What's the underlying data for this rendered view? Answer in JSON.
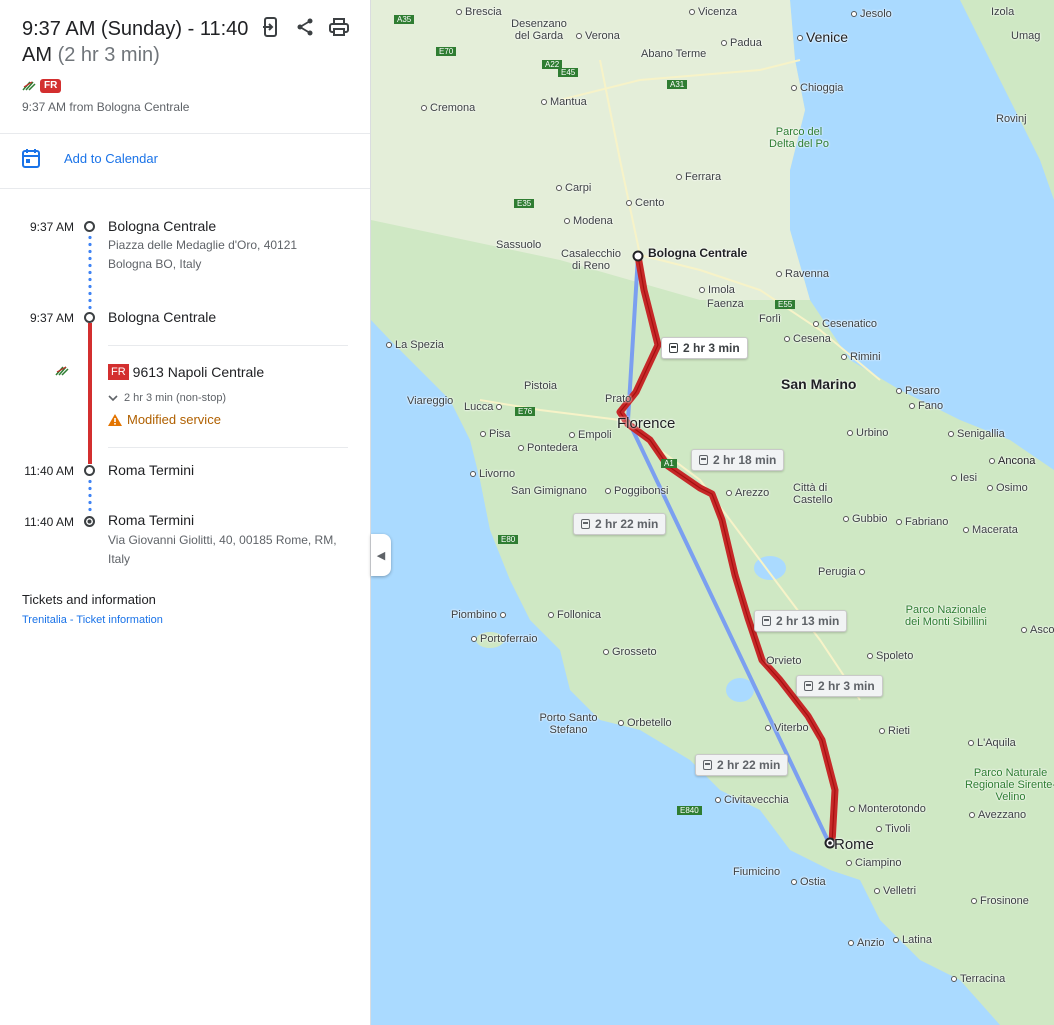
{
  "header": {
    "time_range": "9:37 AM (Sunday) - 11:40 AM",
    "duration": "(2 hr 3 min)",
    "badge": "FR",
    "from_text": "9:37 AM from Bologna Centrale",
    "icons": [
      "send-to-phone-icon",
      "share-icon",
      "print-icon"
    ]
  },
  "calendar": {
    "label": "Add to Calendar"
  },
  "itinerary": {
    "start": {
      "time": "9:37 AM",
      "name": "Bologna Centrale",
      "address_line1": "Piazza delle Medaglie d'Oro, 40121",
      "address_line2": "Bologna BO, Italy"
    },
    "board": {
      "time": "9:37 AM",
      "name": "Bologna Centrale"
    },
    "train": {
      "badge": "FR",
      "label": "9613 Napoli Centrale",
      "duration": "2 hr 3 min (non-stop)",
      "notice": "Modified service"
    },
    "alight": {
      "time": "11:40 AM",
      "name": "Roma Termini"
    },
    "end": {
      "time": "11:40 AM",
      "name": "Roma Termini",
      "address_line1": "Via Giovanni Giolitti, 40, 00185 Rome, RM,",
      "address_line2": "Italy"
    }
  },
  "tickets": {
    "title": "Tickets and information",
    "link": "Trenitalia - Ticket information"
  },
  "map": {
    "route_chips": [
      "2 hr 3 min",
      "2 hr 18 min",
      "2 hr 22 min",
      "2 hr 13 min",
      "2 hr 3 min",
      "2 hr 22 min"
    ],
    "cities": [
      "Brescia",
      "Desenzano del Garda",
      "Verona",
      "Vicenza",
      "Jesolo",
      "Padua",
      "Venice",
      "Abano Terme",
      "Mantua",
      "Cremona",
      "Chioggia",
      "Parco del Delta del Po",
      "Ferrara",
      "Carpi",
      "Cento",
      "Modena",
      "Sassuolo",
      "Casalecchio di Reno",
      "Bologna Centrale",
      "Ravenna",
      "Imola",
      "Faenza",
      "Forlì",
      "Cesenatico",
      "Cesena",
      "Rimini",
      "San Marino",
      "La Spezia",
      "Pesaro",
      "Fano",
      "Pistoia",
      "Viareggio",
      "Prato",
      "Florence",
      "Lucca",
      "Empoli",
      "Urbino",
      "Senigallia",
      "Pisa",
      "Pontedera",
      "Ancona",
      "Livorno",
      "San Gimignano",
      "Poggibonsi",
      "Arezzo",
      "Città di Castello",
      "Iesi",
      "Osimo",
      "Gubbio",
      "Fabriano",
      "Macerata",
      "Perugia",
      "Piombino",
      "Follonica",
      "Portoferraio",
      "Grosseto",
      "Parco Nazionale dei Monti Sibillini",
      "Ascoli Pi",
      "Spoleto",
      "Orvieto",
      "Porto Santo Stefano",
      "Orbetello",
      "Viterbo",
      "Rieti",
      "L'Aquila",
      "Parco Naturale Regionale Sirente-Velino",
      "Civitavecchia",
      "Monterotondo",
      "Avezzano",
      "Tivoli",
      "Rome",
      "Ciampino",
      "Fiumicino",
      "Ostia",
      "Velletri",
      "Frosinone",
      "Anzio",
      "Latina",
      "Terracina",
      "Izola",
      "Umag",
      "Rovinj"
    ],
    "roads": [
      "A35",
      "A22",
      "E70",
      "E45",
      "A31",
      "E35",
      "A1",
      "E76",
      "E80",
      "E840",
      "E55"
    ],
    "colors": {
      "primary_route": "#c62828",
      "alt_route": "#7b9ff0",
      "sea": "#aadaff",
      "land": "#cfe8c4"
    }
  }
}
